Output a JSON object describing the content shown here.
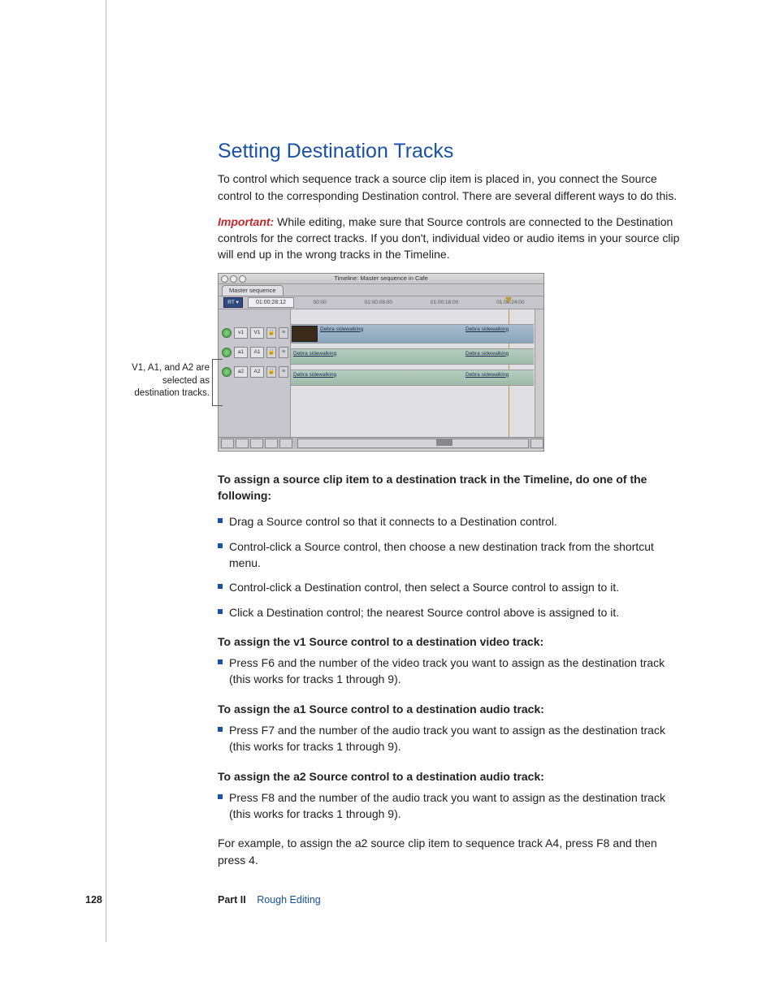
{
  "heading": "Setting Destination Tracks",
  "intro": "To control which sequence track a source clip item is placed in, you connect the Source control to the corresponding Destination control. There are several different ways to do this.",
  "important_label": "Important:",
  "important_text": " While editing, make sure that Source controls are connected to the Destination controls for the correct tracks. If you don't, individual video or audio items in your source clip will end up in the wrong tracks in the Timeline.",
  "screenshot": {
    "window_title": "Timeline: Master sequence in Cafe",
    "tab_label": "Master sequence",
    "rt_label": "RT ▾",
    "timecode": "01:00:28:12",
    "ruler": [
      "00:00",
      "01:00:08:00",
      "01:00:16:00",
      "01:00:24:00"
    ],
    "tracks": {
      "v1": {
        "src": "v1",
        "dst": "V1"
      },
      "a1": {
        "src": "a1",
        "dst": "A1"
      },
      "a2": {
        "src": "a2",
        "dst": "A2"
      }
    },
    "clip_name": "Debra sidewalking"
  },
  "callout": "V1, A1, and A2 are selected as destination tracks.",
  "procedure_head": "To assign a source clip item to a destination track in the Timeline, do one of the following:",
  "steps1": [
    "Drag a Source control so that it connects to a Destination control.",
    "Control-click a Source control, then choose a new destination track from the shortcut menu.",
    "Control-click a Destination control, then select a Source control to assign to it.",
    "Click a Destination control; the nearest Source control above is assigned to it."
  ],
  "sub_v1_head": "To assign the v1 Source control to a destination video track:",
  "sub_v1_step": "Press F6 and the number of the video track you want to assign as the destination track (this works for tracks 1 through 9).",
  "sub_a1_head": "To assign the a1 Source control to a destination audio track:",
  "sub_a1_step": "Press F7 and the number of the audio track you want to assign as the destination track (this works for tracks 1 through 9).",
  "sub_a2_head": "To assign the a2 Source control to a destination audio track:",
  "sub_a2_step": "Press F8 and the number of the audio track you want to assign as the destination track (this works for tracks 1 through 9).",
  "example": "For example, to assign the a2 source clip item to sequence track A4, press F8 and then press 4.",
  "footer": {
    "page": "128",
    "part": "Part II",
    "chapter": "Rough Editing"
  }
}
